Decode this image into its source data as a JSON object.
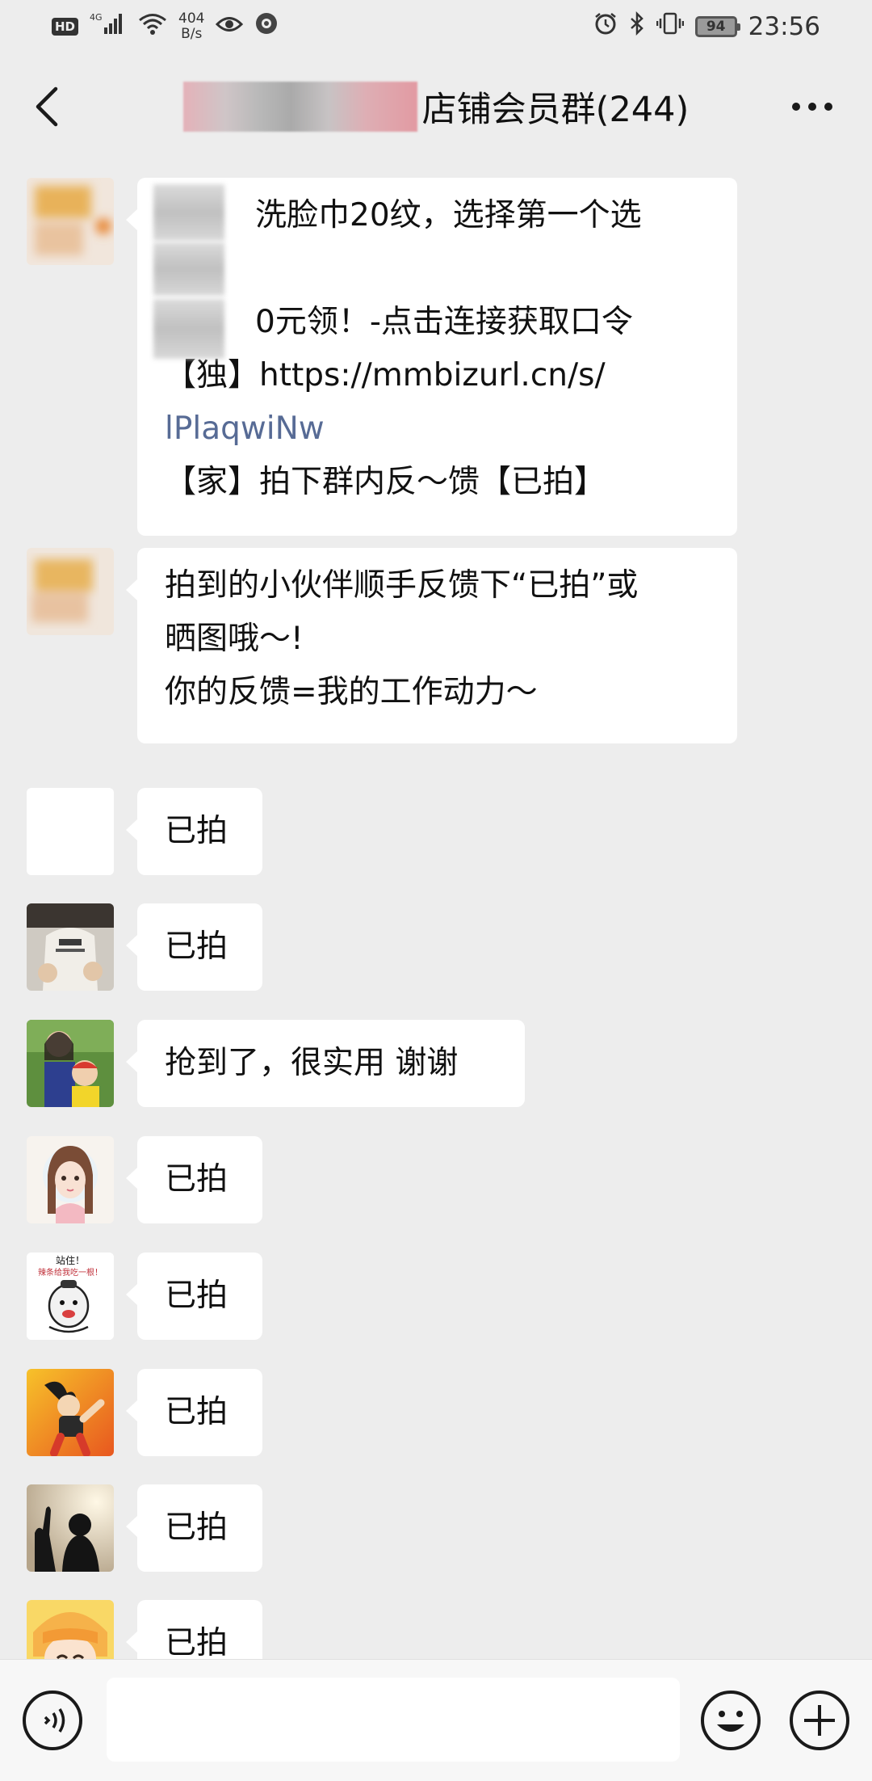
{
  "status_bar": {
    "hd_label": "HD",
    "network_label": "4G",
    "speed_value": "404",
    "speed_unit": "B/s",
    "battery_level": "94",
    "time": "23:56"
  },
  "header": {
    "title_visible": "店铺会员群(244)"
  },
  "messages": [
    {
      "lines": [
        "洗脸巾20纹，选择第一个选",
        "",
        "0元领！-点击连接获取口令",
        "【独】https://mmbizurl.cn/s/",
        "lPlaqwiNw",
        "【家】拍下群内反～馈【已拍】"
      ]
    },
    {
      "lines": [
        "拍到的小伙伴顺手反馈下“已拍”或",
        "晒图哦～!",
        "你的反馈=我的工作动力～"
      ]
    },
    {
      "text": "已拍"
    },
    {
      "text": "已拍"
    },
    {
      "text": "抢到了，很实用 谢谢"
    },
    {
      "text": "已拍"
    },
    {
      "text": "已拍",
      "avatar_caption_top": "站住！",
      "avatar_caption_bottom": "辣条给我吃一根！"
    },
    {
      "text": "已拍"
    },
    {
      "text": "已拍"
    },
    {
      "text": "已拍"
    }
  ],
  "input": {
    "value": ""
  },
  "icons": {
    "back": "chevron-left-icon",
    "more": "more-dots-icon",
    "voice": "voice-icon",
    "emoji": "emoji-icon",
    "plus": "plus-icon"
  },
  "colors": {
    "background": "#ededed",
    "bubble": "#ffffff",
    "link": "#576b95"
  }
}
